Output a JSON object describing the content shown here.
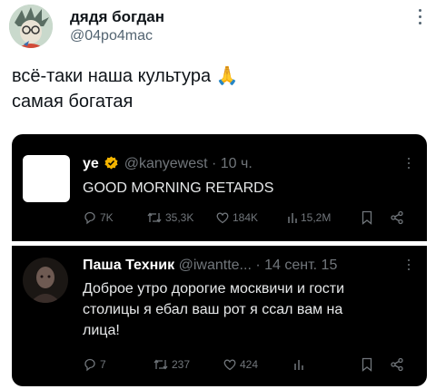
{
  "author": {
    "name": "дядя богдан",
    "handle": "@04po4mac"
  },
  "tweet": {
    "line1": "всё-таки наша культура 🙏",
    "line2": "самая богатая"
  },
  "quoted": [
    {
      "name": "ye",
      "handle": "@kanyewest",
      "time": "· 10 ч.",
      "text": "GOOD MORNING RETARDS",
      "stats": {
        "replies": "7K",
        "reposts": "35,3K",
        "likes": "184K",
        "views": "15,2M"
      }
    },
    {
      "name": "Паша Техник",
      "handle": "@iwantte...",
      "time": "· 14 сент. 15",
      "text_lines": [
        "Доброе утро дорогие москвичи и гости",
        "столицы я ебал ваш рот я ссал вам на",
        "лица!"
      ],
      "stats": {
        "replies": "7",
        "reposts": "237",
        "likes": "424",
        "views": ""
      }
    }
  ],
  "colors": {
    "verified_badge": "#f4b400",
    "dark_bg": "#000000",
    "muted": "#71767b"
  }
}
